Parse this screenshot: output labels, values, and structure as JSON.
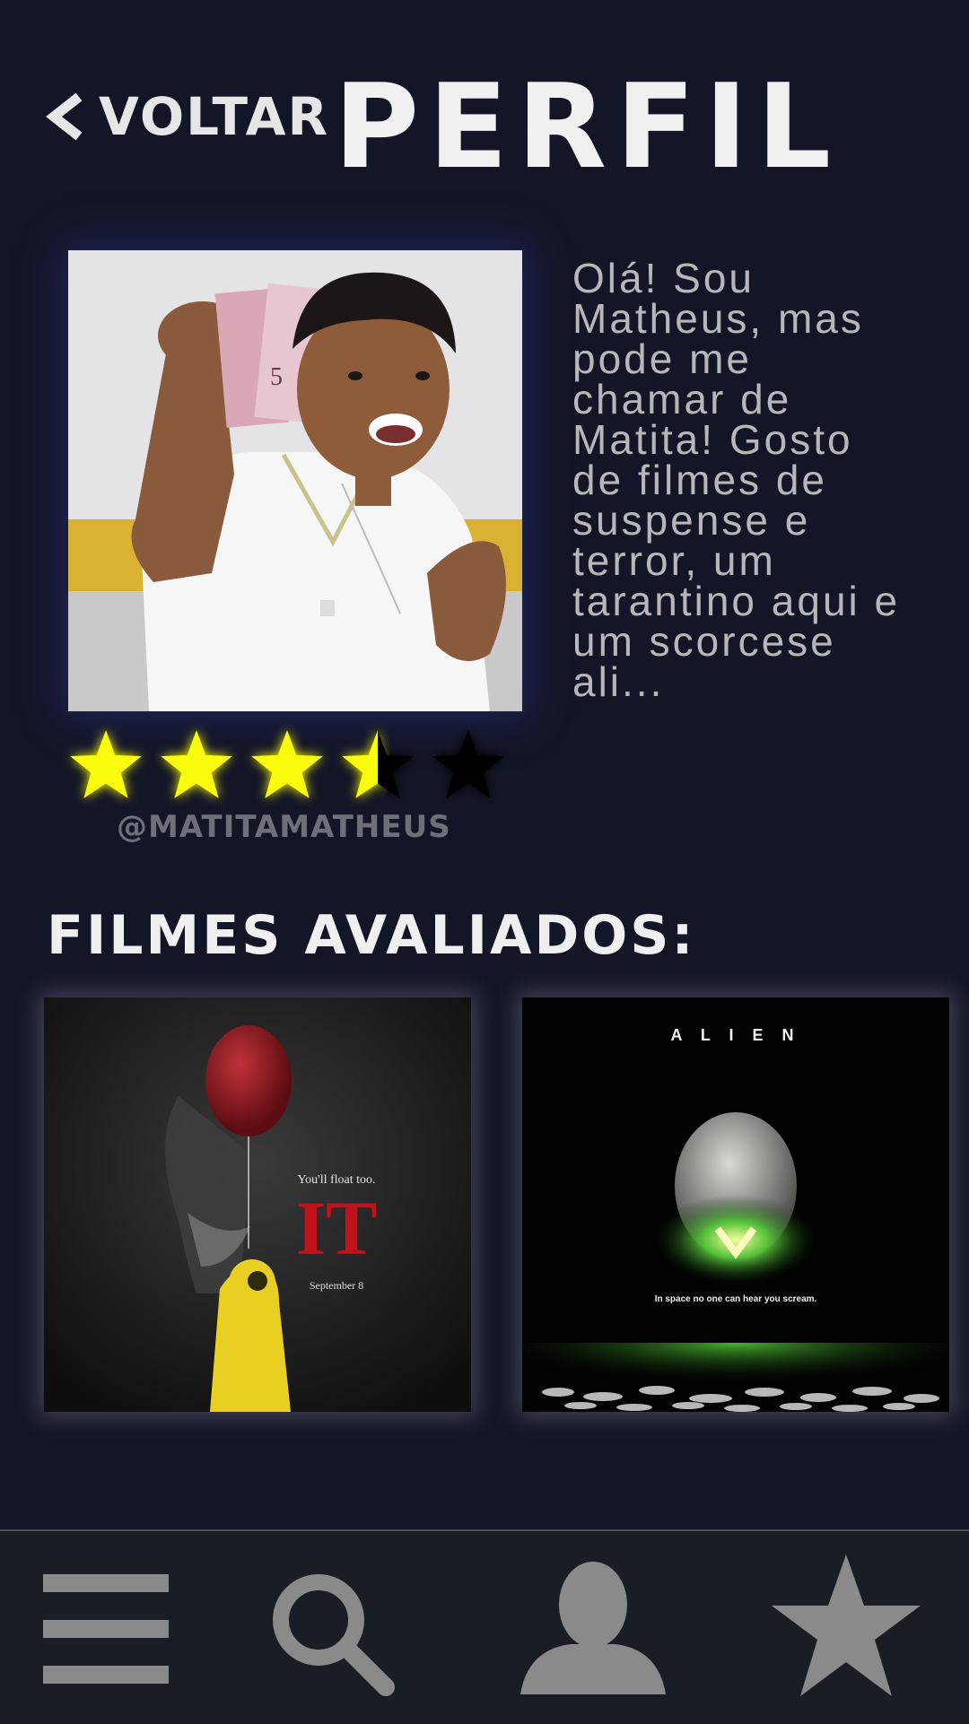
{
  "header": {
    "back_label": "VOLTAR",
    "title": "PERFIL"
  },
  "profile": {
    "bio": "Olá!  Sou\nMatheus, mas\npode me\nchamar de\nMatita! Gosto\nde filmes de\nsuspense e\nterror, um\ntarantino aqui e\num scorcese\nali...",
    "rating": 3.5,
    "rating_max": 5,
    "username": "@MATITAMATHEUS"
  },
  "section": {
    "title": "FILMES AVALIADOS:"
  },
  "movies": [
    {
      "tagline": "You'll float too.",
      "title": "IT",
      "date": "September 8"
    },
    {
      "title": "A L I E N",
      "tagline": "In space no one can hear you scream."
    }
  ],
  "colors": {
    "background": "#141628",
    "star_filled": "#fbfb0a",
    "star_empty": "#000000",
    "nav_background": "#1b1d24",
    "nav_icon": "#8a8a8a"
  },
  "nav": {
    "items": [
      "menu-icon",
      "search-icon",
      "profile-icon",
      "star-icon"
    ]
  }
}
